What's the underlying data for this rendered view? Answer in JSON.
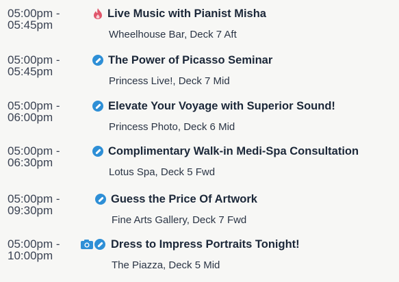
{
  "events": [
    {
      "time": "05:00pm -\n05:45pm",
      "title": "Live Music with Pianist Misha",
      "location": "Wheelhouse Bar, Deck 7  Aft",
      "icon": "flame-icon"
    },
    {
      "time": "05:00pm -\n05:45pm",
      "title": "The Power of Picasso Seminar",
      "location": "Princess Live!, Deck 7  Mid",
      "icon": "compass-icon"
    },
    {
      "time": "05:00pm -\n06:00pm",
      "title": "Elevate Your Voyage with Superior Sound!",
      "location": "Princess Photo, Deck 6  Mid",
      "icon": "compass-icon"
    },
    {
      "time": "05:00pm -\n06:30pm",
      "title": "Complimentary Walk-in Medi-Spa Consultation",
      "location": "Lotus Spa, Deck 5  Fwd",
      "icon": "compass-icon"
    },
    {
      "time": "05:00pm -\n09:30pm",
      "title": "Guess the Price Of Artwork",
      "location": "Fine Arts Gallery, Deck 7  Fwd",
      "icon": "compass-icon"
    },
    {
      "time": "05:00pm -\n10:00pm",
      "title": "Dress to Impress Portraits Tonight!",
      "location": "The Piazza, Deck 5  Mid",
      "icon": "camera-icon + compass-icon"
    }
  ],
  "colors": {
    "compass": "#2e8fd6",
    "flame": "#e0566b",
    "camera": "#2e8fd6",
    "text": "#1b2738"
  }
}
